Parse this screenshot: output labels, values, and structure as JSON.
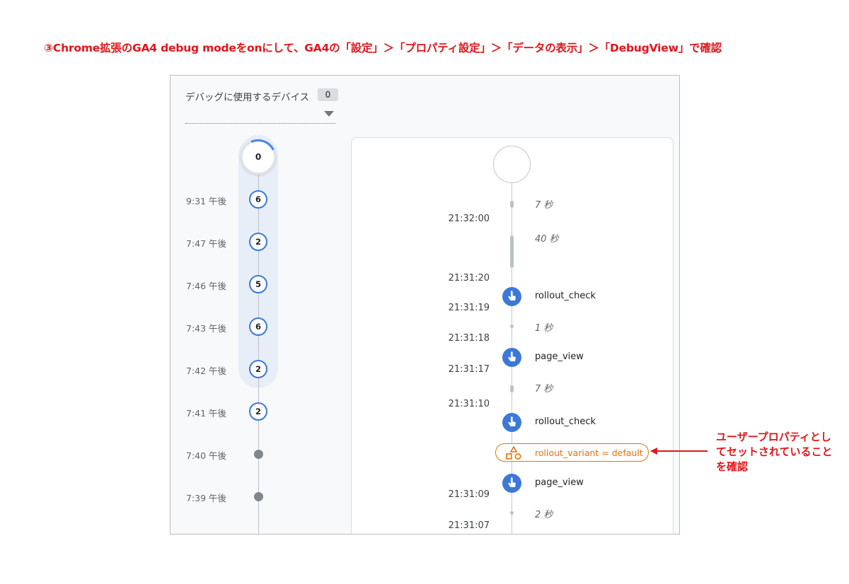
{
  "headline": "③Chrome拡張のGA4 debug modeをonにして、GA4の「設定」＞「プロパティ設定」＞「データの表示」＞「DebugView」で確認",
  "device_selector": {
    "label": "デバッグに使用するデバイス",
    "count": "0"
  },
  "minute_timeline": {
    "top_count": "0",
    "rows": [
      {
        "time": "9:31 午後",
        "count": "6"
      },
      {
        "time": "7:47 午後",
        "count": "2"
      },
      {
        "time": "7:46 午後",
        "count": "5"
      },
      {
        "time": "7:43 午後",
        "count": "6"
      },
      {
        "time": "7:42 午後",
        "count": "2"
      },
      {
        "time": "7:41 午後",
        "count": "2"
      },
      {
        "time": "7:40 午後",
        "count": ""
      },
      {
        "time": "7:39 午後",
        "count": ""
      }
    ]
  },
  "seconds_stream": {
    "gaps": [
      "7 秒",
      "40 秒",
      "1 秒",
      "7 秒",
      "2 秒"
    ],
    "times": [
      "21:32:00",
      "21:31:20",
      "21:31:19",
      "21:31:18",
      "21:31:17",
      "21:31:10",
      "21:31:09",
      "21:31:07"
    ],
    "events": [
      "rollout_check",
      "page_view",
      "rollout_check",
      "page_view"
    ],
    "user_property": "rollout_variant = default"
  },
  "annotation": "ユーザープロパティとしてセットされていることを確認",
  "colors": {
    "accent_red": "#e0161a",
    "event_blue": "#3c78d8",
    "property_orange": "#e8710a"
  }
}
